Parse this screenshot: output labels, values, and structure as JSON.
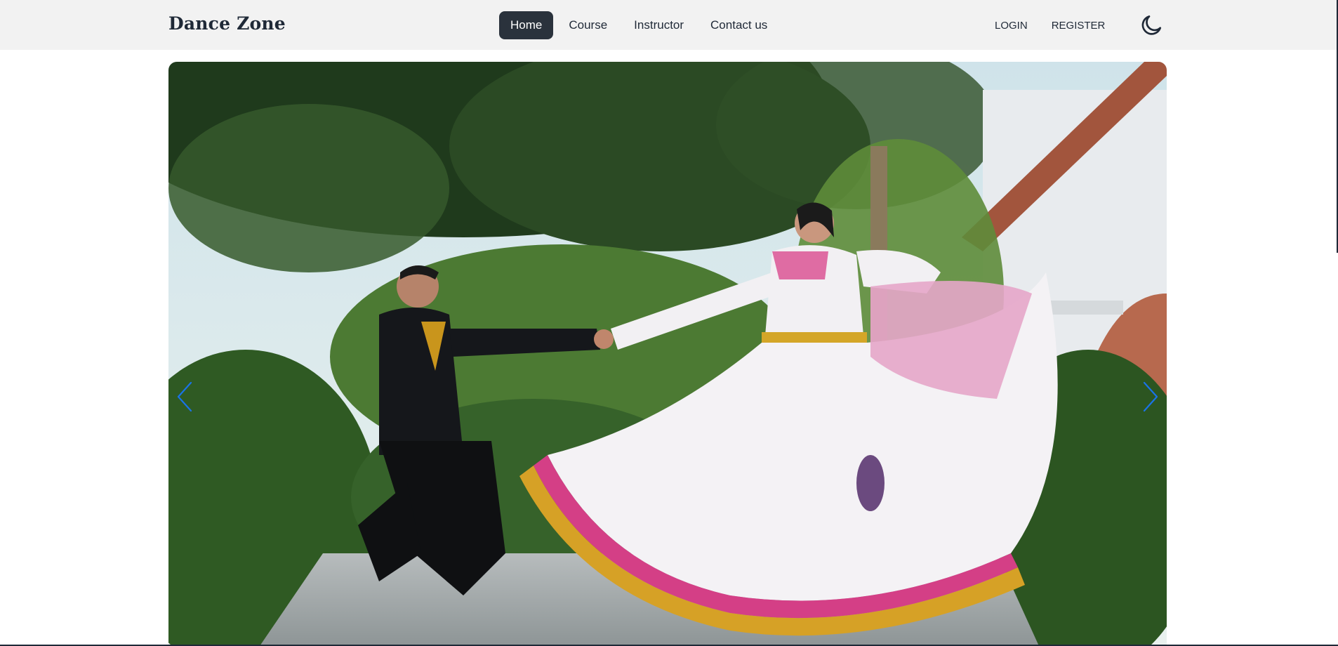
{
  "brand": {
    "name": "Dance Zone"
  },
  "nav": {
    "items": [
      {
        "label": "Home",
        "active": true
      },
      {
        "label": "Course",
        "active": false
      },
      {
        "label": "Instructor",
        "active": false
      },
      {
        "label": "Contact us",
        "active": false
      }
    ]
  },
  "auth": {
    "login_label": "LOGIN",
    "register_label": "REGISTER"
  },
  "icons": {
    "theme_toggle": "moon-icon",
    "carousel_prev": "chevron-left-icon",
    "carousel_next": "chevron-right-icon"
  },
  "colors": {
    "navbar_bg": "#f2f2f2",
    "active_nav_bg": "#2a323c",
    "text_dark": "#1f2937",
    "arrow_blue": "#1a73e8"
  }
}
